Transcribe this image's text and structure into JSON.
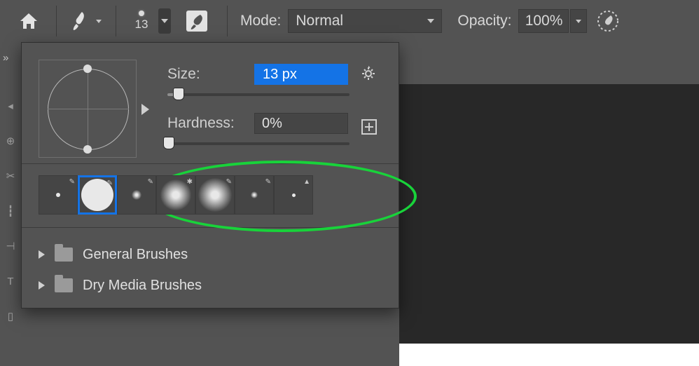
{
  "topbar": {
    "brush_size_number": "13",
    "mode_label": "Mode:",
    "mode_value": "Normal",
    "opacity_label": "Opacity:",
    "opacity_value": "100%"
  },
  "popup": {
    "size_label": "Size:",
    "size_value": "13 px",
    "hardness_label": "Hardness:",
    "hardness_value": "0%",
    "size_slider_pct": 5,
    "hardness_slider_pct": 0
  },
  "folders": [
    {
      "name": "General Brushes"
    },
    {
      "name": "Dry Media Brushes"
    }
  ],
  "icons": {
    "brush_corner": "✎",
    "pressure_corner": "▲",
    "spatter_corner": "✱"
  }
}
